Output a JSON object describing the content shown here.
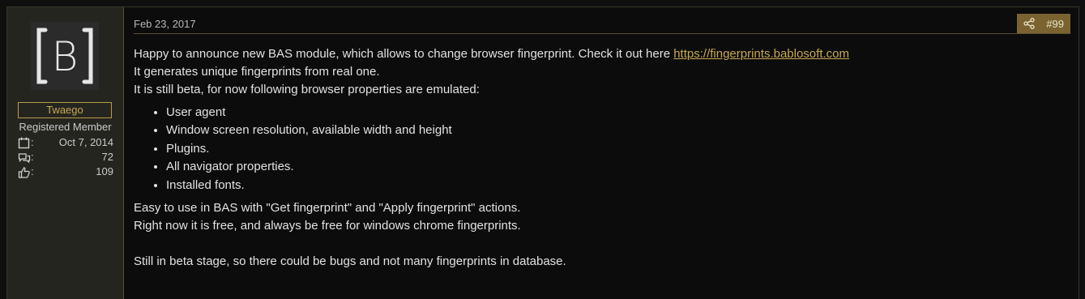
{
  "user": {
    "avatar_initial": "B",
    "username": "Twaego",
    "title": "Registered Member",
    "stats": [
      {
        "icon": "calendar-icon",
        "colon": ":",
        "value": "Oct 7, 2014"
      },
      {
        "icon": "messages-icon",
        "colon": ":",
        "value": "72"
      },
      {
        "icon": "thumbs-up-icon",
        "colon": ":",
        "value": "109"
      }
    ]
  },
  "post": {
    "date": "Feb 23, 2017",
    "number": "#99",
    "share_icon": "share-icon",
    "intro": "Happy to announce new BAS module, which allows to change browser fingerprint. Check it out here ",
    "link": "https://fingerprints.bablosoft.com",
    "line2": "It generates unique fingerprints from real one.",
    "line3": "It is still beta, for now following browser properties are emulated:",
    "bullets": [
      "User agent",
      "Window screen resolution, available width and height",
      "Plugins.",
      "All navigator properties.",
      "Installed fonts."
    ],
    "line4": "Easy to use in BAS with \"Get fingerprint\" and \"Apply fingerprint\" actions.",
    "line5": "Right now it is free, and always be free for windows chrome fingerprints.",
    "line6": "Still in beta stage, so there could be bugs and not many fingerprints in database."
  },
  "colors": {
    "accent": "#c8a850",
    "header_bar": "#7a6330",
    "sidebar_bg": "#252520"
  }
}
